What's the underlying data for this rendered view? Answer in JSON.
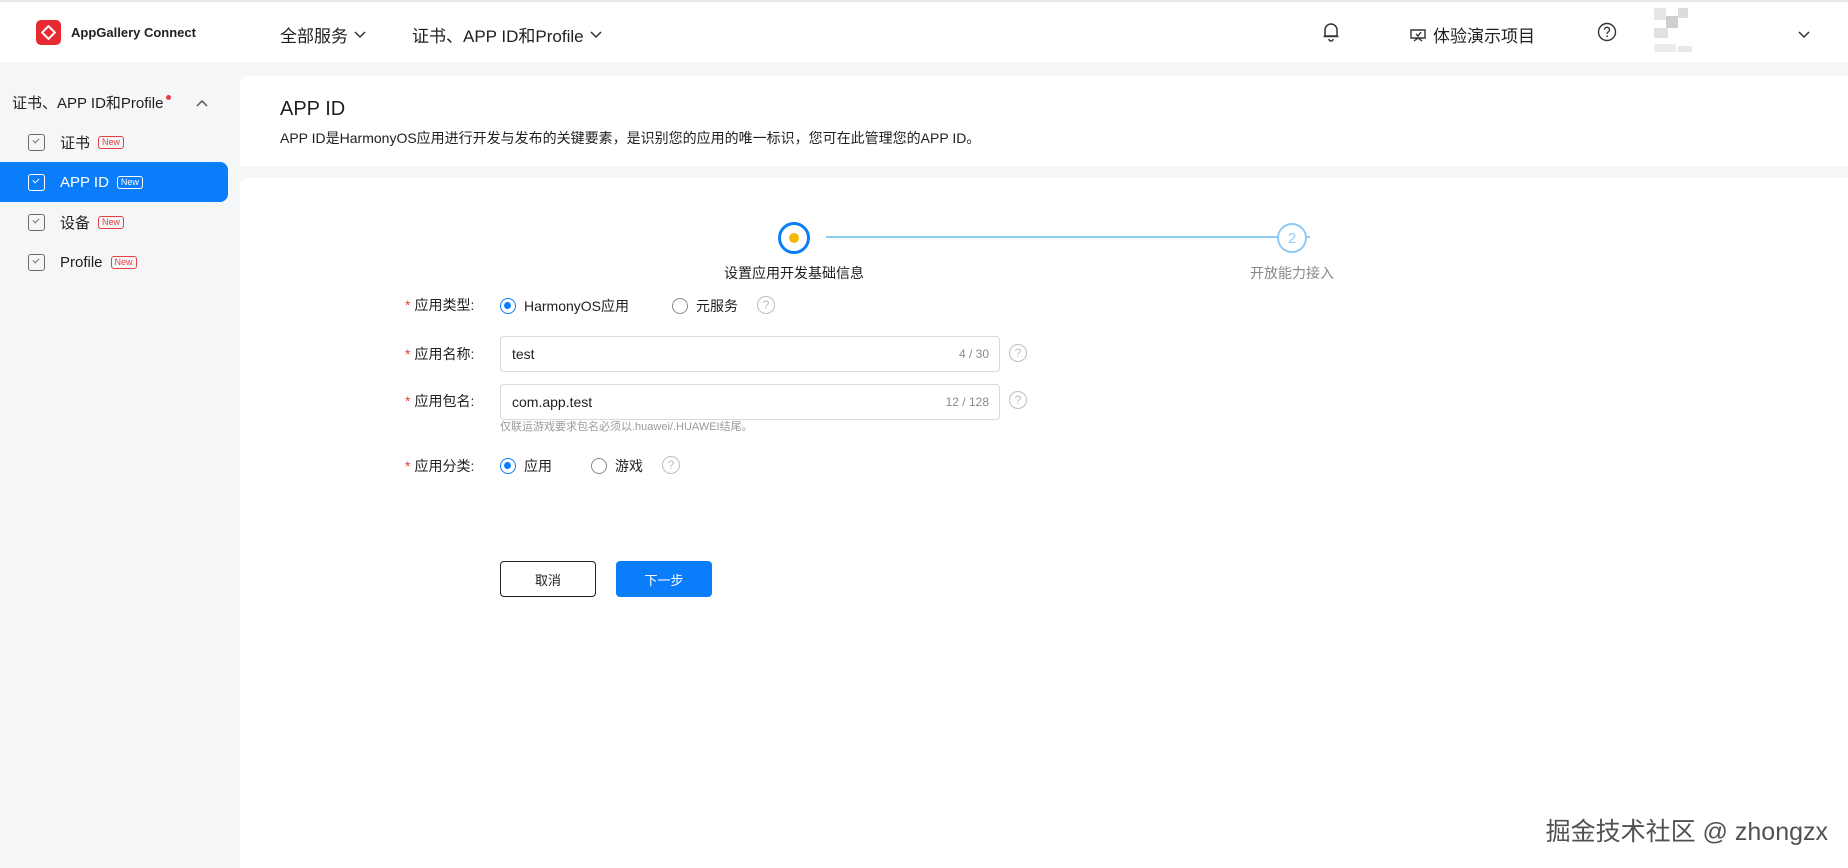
{
  "topbar": {
    "brand_name": "AppGallery Connect",
    "menu_all_services": "全部服务",
    "menu_cert": "证书、APP ID和Profile",
    "demo_project": "体验演示项目"
  },
  "sidebar": {
    "group_label": "证书、APP ID和Profile",
    "items": [
      {
        "label": "证书",
        "badge": "New"
      },
      {
        "label": "APP ID",
        "badge": "New"
      },
      {
        "label": "设备",
        "badge": "New"
      },
      {
        "label": "Profile",
        "badge": "New"
      }
    ]
  },
  "header": {
    "title": "APP ID",
    "description": "APP ID是HarmonyOS应用进行开发与发布的关键要素，是识别您的应用的唯一标识，您可在此管理您的APP ID。"
  },
  "stepper": {
    "step1_label": "设置应用开发基础信息",
    "step2_number": "2",
    "step2_label": "开放能力接入"
  },
  "form": {
    "required_mark": "*",
    "app_type_label": "应用类型:",
    "app_type_options": [
      "HarmonyOS应用",
      "元服务"
    ],
    "app_name_label": "应用名称:",
    "app_name_value": "test",
    "app_name_count": "4 / 30",
    "package_label": "应用包名:",
    "package_value": "com.app.test",
    "package_count": "12 / 128",
    "package_hint": "仅联运游戏要求包名必须以.huawei/.HUAWEI结尾。",
    "category_label": "应用分类:",
    "category_options": [
      "应用",
      "游戏"
    ],
    "help_glyph": "?",
    "cancel_label": "取消",
    "next_label": "下一步"
  },
  "watermark": "掘金技术社区 @ zhongzx",
  "colors": {
    "primary": "#0a7dfa",
    "step_inactive": "#8ecbf5",
    "step_dot": "#f5b800",
    "brand_red": "#e52a33",
    "required": "#e84040"
  }
}
